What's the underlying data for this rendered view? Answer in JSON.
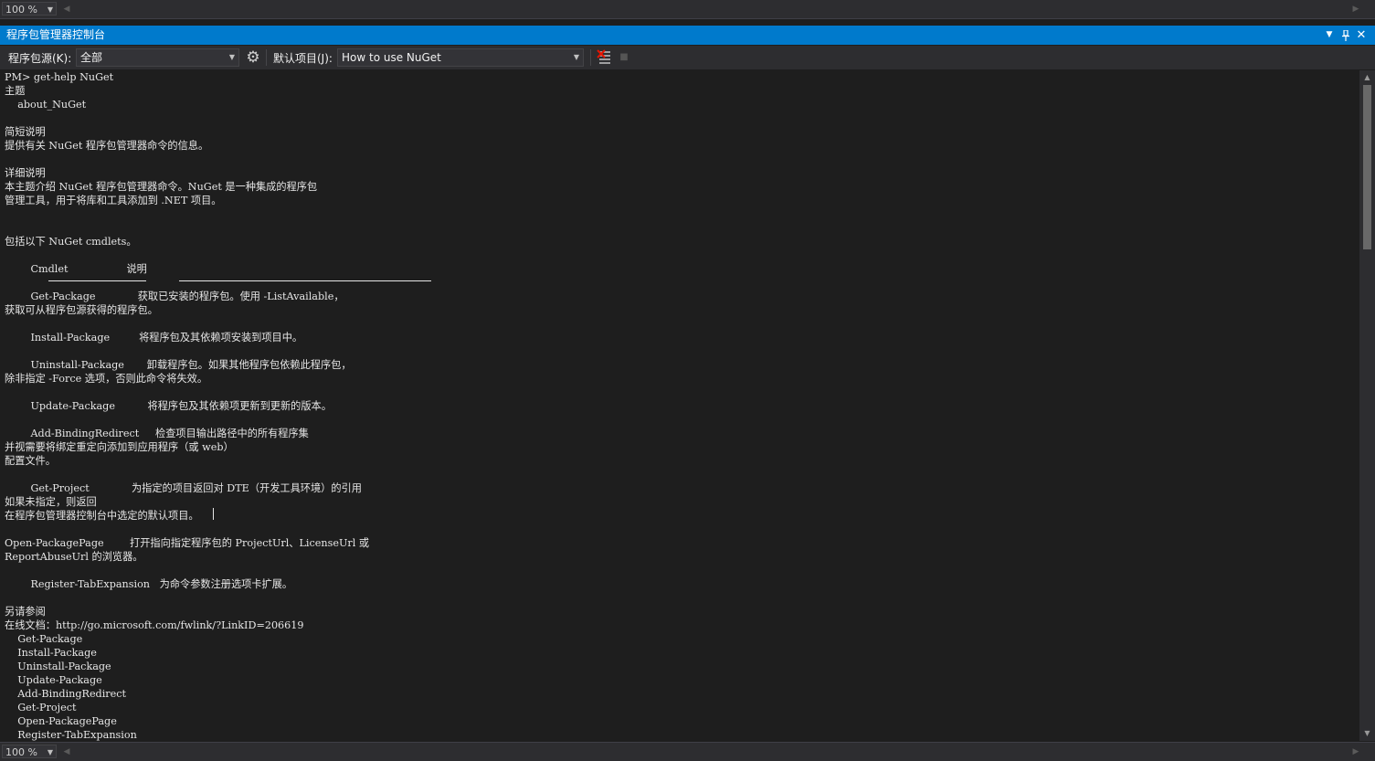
{
  "zoom_top": {
    "value": "100 %"
  },
  "titlebar": {
    "title": "程序包管理器控制台",
    "dropdown_glyph": "▼",
    "pin_glyph": "⊥",
    "close_glyph": "✕"
  },
  "toolbar": {
    "source_label": "程序包源(K):",
    "source_value": "全部",
    "settings_glyph": "⚙",
    "default_project_label": "默认项目(J):",
    "default_project_value": "How to use NuGet",
    "clear_glyph": "☰",
    "stop_glyph": "■"
  },
  "console": {
    "lines": [
      "PM> get-help NuGet",
      "主题",
      "    about_NuGet",
      "",
      "简短说明",
      "提供有关 NuGet 程序包管理器命令的信息。",
      "",
      "详细说明",
      "本主题介绍 NuGet 程序包管理器命令。NuGet 是一种集成的程序包",
      "管理工具，用于将库和工具添加到 .NET 项目。",
      "",
      "",
      "包括以下 NuGet cmdlets。",
      "",
      "        Cmdlet                  说明",
      "",
      "        Get-Package             获取已安装的程序包。使用 -ListAvailable，",
      "获取可从程序包源获得的程序包。",
      "",
      "        Install-Package         将程序包及其依赖项安装到项目中。",
      "",
      "        Uninstall-Package       卸载程序包。如果其他程序包依赖此程序包，",
      "除非指定 -Force 选项，否则此命令将失效。",
      "",
      "        Update-Package          将程序包及其依赖项更新到更新的版本。",
      "",
      "        Add-BindingRedirect     检查项目输出路径中的所有程序集",
      "并视需要将绑定重定向添加到应用程序（或 web）",
      "配置文件。",
      "",
      "        Get-Project             为指定的项目返回对 DTE（开发工具环境）的引用",
      "如果未指定，则返回",
      "在程序包管理器控制台中选定的默认项目。",
      "",
      "Open-PackagePage        打开指向指定程序包的 ProjectUrl、LicenseUrl 或",
      "ReportAbuseUrl 的浏览器。",
      "",
      "        Register-TabExpansion   为命令参数注册选项卡扩展。",
      "",
      "另请参阅",
      "在线文档：http://go.microsoft.com/fwlink/?LinkID=206619",
      "    Get-Package",
      "    Install-Package",
      "    Uninstall-Package",
      "    Update-Package",
      "    Add-BindingRedirect",
      "    Get-Project",
      "    Open-PackagePage",
      "    Register-TabExpansion"
    ]
  },
  "zoom_bottom": {
    "value": "100 %"
  },
  "colors": {
    "accent": "#007acc",
    "background": "#1e1e1e",
    "chrome": "#2d2d30"
  }
}
